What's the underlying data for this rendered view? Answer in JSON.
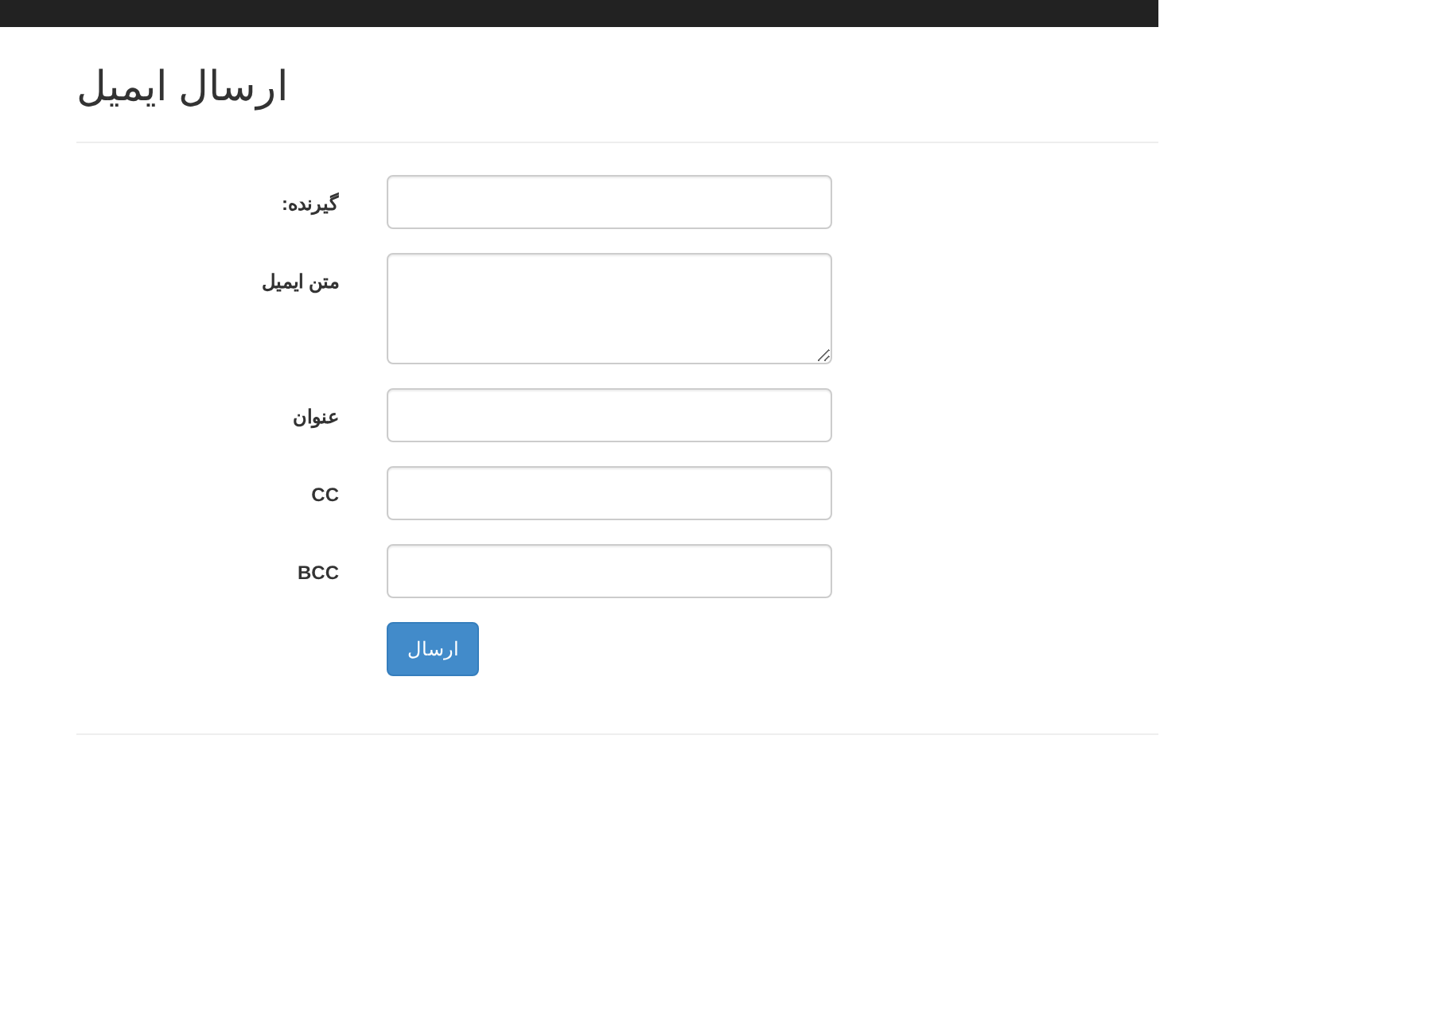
{
  "page": {
    "title": "ارسال ایمیل"
  },
  "form": {
    "fields": [
      {
        "kind": "input",
        "label": "گیرنده:"
      },
      {
        "kind": "textarea",
        "label": "متن ایمیل"
      },
      {
        "kind": "input",
        "label": "عنوان"
      },
      {
        "kind": "input",
        "label": "CC"
      },
      {
        "kind": "input",
        "label": "BCC"
      }
    ],
    "submit": "ارسال"
  }
}
